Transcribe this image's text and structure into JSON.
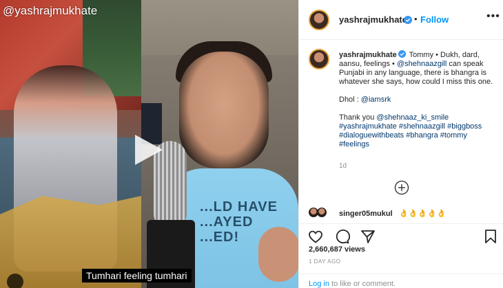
{
  "video": {
    "watermark": "@yashrajmukhate",
    "shirt_text": "...LD HAVE\n...AYED\n...ED!",
    "caption": "Tumhari feeling tumhari"
  },
  "post": {
    "username": "yashrajmukhate",
    "dot": "•",
    "follow_label": "Follow",
    "more_label": "•••",
    "caption_user": "yashrajmukhate",
    "caption_line1_pre": " Tommy • Dukh, dard, aansu, feelings • ",
    "caption_mention1": "@shehnaazgill",
    "caption_line1_post": " can speak Punjabi in any language, there is bhangra is whatever she says, how could I miss this one.",
    "caption_dhol": "Dhol : ",
    "caption_mention2": "@iamsrk",
    "caption_thanks": "Thank you ",
    "caption_mention3": "@shehnaaz_ki_smile",
    "hashtags": "#yashrajmukhate #shehnaazgill #biggboss #dialoguewithbeats #bhangra #tommy #feelings",
    "time_short": "1d",
    "comment_user": "singer05mukul",
    "comment_text": "👌👌👌👌👌",
    "views": "2,660,687 views",
    "day_ago": "1 DAY AGO",
    "login_link": "Log in",
    "login_rest": " to like or comment."
  },
  "colors": {
    "accent": "#0095f6",
    "verified": "#3897f0",
    "text": "#262626",
    "muted": "#8e8e8e",
    "link": "#00376b"
  },
  "icons": {
    "play": "play-icon",
    "verified": "verified-badge-icon",
    "like": "heart-icon",
    "comment": "comment-icon",
    "share": "paper-plane-icon",
    "save": "bookmark-icon",
    "load_more": "plus-circle-icon",
    "more": "more-options-icon"
  }
}
